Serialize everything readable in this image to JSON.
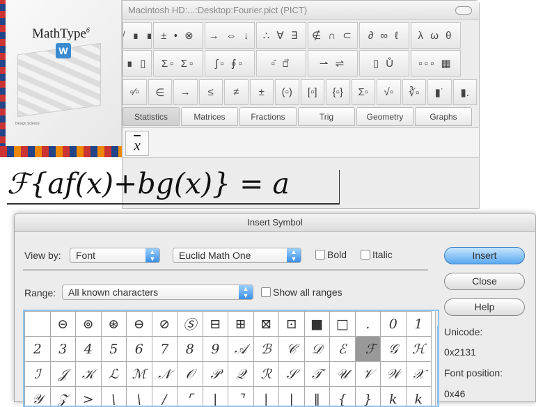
{
  "product_box": {
    "brand": "MathType",
    "version": "6",
    "small_text": "Design Science"
  },
  "window": {
    "title": "Macintosh HD:...:Desktop:Fourier.pict (PICT)",
    "row1": [
      "√ ∎ ∎",
      "± • ⊗",
      "→ ⇔ ↓",
      "∴ ∀ ∃",
      "∉ ∩ ⊂",
      "∂ ∞ ℓ",
      "λ ω θ"
    ],
    "row2": [
      "∎ ▯",
      "Σ▫ Σ▫",
      "∫▫ ∮▫",
      "▫̄ ▫⃗",
      "⇀ ⇌",
      "▯ Ů",
      "▫▫▫ ▦"
    ],
    "row3": [
      "▫⁄▫",
      "∈",
      "→",
      "≤",
      "≠",
      "±",
      "(▫)",
      "[▫]",
      "{▫}",
      "Σ▫",
      "√▫",
      "∛▫",
      "▮˙",
      "▮."
    ],
    "tabs": [
      "Statistics",
      "Matrices",
      "Fractions",
      "Trig",
      "Geometry",
      "Graphs"
    ],
    "tab_content": "x"
  },
  "equation": "ℱ{af(x)+bg(x)} = a",
  "dialog": {
    "title": "Insert Symbol",
    "view_by_label": "View by:",
    "view_by_value": "Font",
    "font_value": "Euclid Math One",
    "bold_label": "Bold",
    "italic_label": "Italic",
    "range_label": "Range:",
    "range_value": "All known characters",
    "show_all_label": "Show all ranges",
    "buttons": {
      "insert": "Insert",
      "close": "Close",
      "help": "Help"
    },
    "unicode_label": "Unicode:",
    "unicode_value": "0x2131",
    "font_position_label": "Font position:",
    "font_position_value": "0x46",
    "selected_char": "ℱ",
    "grid": [
      [
        "",
        "⊝",
        "⊚",
        "⊛",
        "⊖",
        "⊘",
        "Ⓢ",
        "⊟",
        "⊞",
        "⊠",
        "⊡",
        "■",
        "□",
        ".",
        "0",
        "1"
      ],
      [
        "2",
        "3",
        "4",
        "5",
        "6",
        "7",
        "8",
        "9",
        "𝒜",
        "ℬ",
        "𝒞",
        "𝒟",
        "ℰ",
        "ℱ",
        "𝒢",
        "ℋ"
      ],
      [
        "ℐ",
        "𝒥",
        "𝒦",
        "ℒ",
        "ℳ",
        "𝒩",
        "𝒪",
        "𝒫",
        "𝒬",
        "ℛ",
        "𝒮",
        "𝒯",
        "𝒰",
        "𝒱",
        "𝒲",
        "𝒳"
      ],
      [
        "𝒴",
        "𝒵",
        ">",
        "\\",
        "\\",
        "/",
        "⌜",
        "|",
        "⌝",
        "|",
        "|",
        "‖",
        "{",
        "}",
        "k",
        "k"
      ]
    ]
  }
}
